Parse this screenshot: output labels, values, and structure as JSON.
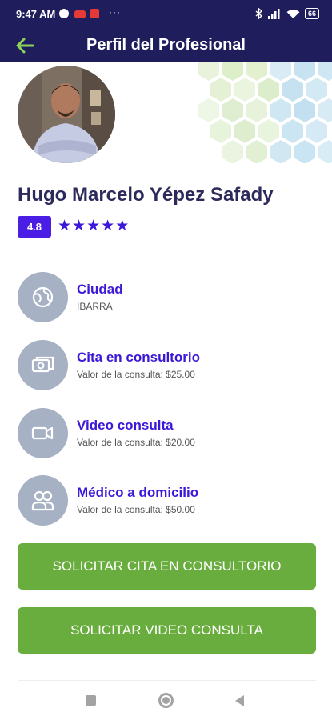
{
  "status_bar": {
    "time": "9:47 AM",
    "battery": "66",
    "icons": [
      "google-icon",
      "youtube-icon",
      "app-icon",
      "more-dots-icon",
      "bluetooth-icon",
      "signal-icon",
      "wifi-icon",
      "battery-icon"
    ],
    "more": "···"
  },
  "app_bar": {
    "title": "Perfil del Profesional",
    "back_icon": "arrow-left-icon",
    "accent": "#8cd35a"
  },
  "profile": {
    "name": "Hugo Marcelo Yépez Safady",
    "rating": "4.8",
    "stars": 5
  },
  "info_items": [
    {
      "label": "Ciudad",
      "value": "IBARRA",
      "icon": "globe-icon"
    },
    {
      "label": "Cita en consultorio",
      "value": "Valor de la consulta: $25.00",
      "icon": "camera-icon"
    },
    {
      "label": "Video consulta",
      "value": "Valor de la consulta: $20.00",
      "icon": "video-icon"
    },
    {
      "label": "Médico a domicilio",
      "value": "Valor de la consulta: $50.00",
      "icon": "users-icon"
    }
  ],
  "buttons": {
    "office": "SOLICITAR CITA EN CONSULTORIO",
    "video": "SOLICITAR VIDEO CONSULTA"
  },
  "colors": {
    "header": "#1f1d5c",
    "accent_purple": "#3d18d8",
    "button_green": "#6aad3f",
    "icon_circle": "#a6b1c4"
  }
}
